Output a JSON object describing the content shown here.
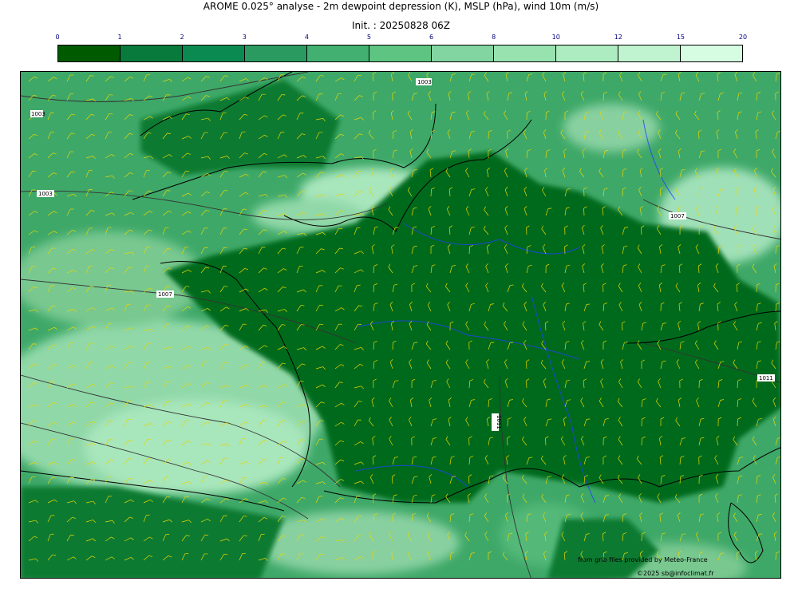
{
  "header": {
    "title": "AROME 0.025° analyse - 2m dewpoint depression (K), MSLP (hPa), wind 10m (m/s)",
    "init": "Init. : 20250828 06Z"
  },
  "colorbar": {
    "ticks": [
      "0",
      "1",
      "2",
      "3",
      "4",
      "5",
      "6",
      "8",
      "10",
      "12",
      "15",
      "20"
    ],
    "colors": [
      "#005a00",
      "#087a3c",
      "#0a8a50",
      "#2a9a60",
      "#42b070",
      "#5ec482",
      "#82d4a0",
      "#98e2b0",
      "#acecc0",
      "#c0f4d0",
      "#d6fce2"
    ]
  },
  "map": {
    "isobar_labels": [
      "1003",
      "1003",
      "1003",
      "1007",
      "1007",
      "1011",
      "1011"
    ],
    "wind_color": "#e6d800",
    "coast_color": "#000000",
    "river_color": "#2040ff"
  },
  "credits": {
    "line1": "from grib files provided by Meteo-France",
    "line2": "©2025 sb@infoclimat.fr"
  }
}
